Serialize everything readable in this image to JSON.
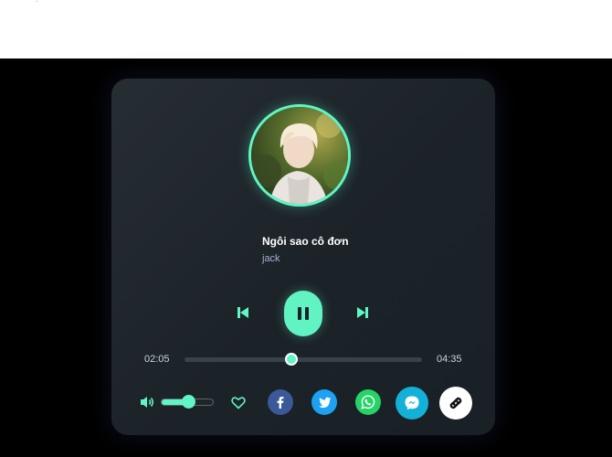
{
  "track": {
    "title": "Ngôi sao cô đơn",
    "artist": "jack"
  },
  "playback": {
    "current_time": "02:05",
    "duration": "04:35",
    "progress_fraction": 0.45,
    "is_playing": true
  },
  "volume": {
    "level_fraction": 0.5
  },
  "controls": {
    "prev_icon": "skip-previous-icon",
    "play_pause_icon": "pause-icon",
    "next_icon": "skip-next-icon",
    "volume_icon": "speaker-icon",
    "favorite_icon": "heart-outline-icon"
  },
  "share": {
    "facebook_icon": "facebook-icon",
    "twitter_icon": "twitter-icon",
    "whatsapp_icon": "whatsapp-icon",
    "messenger_icon": "messenger-icon",
    "copy_link_icon": "link-icon"
  },
  "colors": {
    "accent": "#5ff5c4",
    "card_bg": "#1f262c",
    "page_bg": "#000000",
    "facebook": "#3b5998",
    "twitter": "#1da1f2",
    "whatsapp": "#25d366",
    "messenger": "#13b1d8"
  }
}
